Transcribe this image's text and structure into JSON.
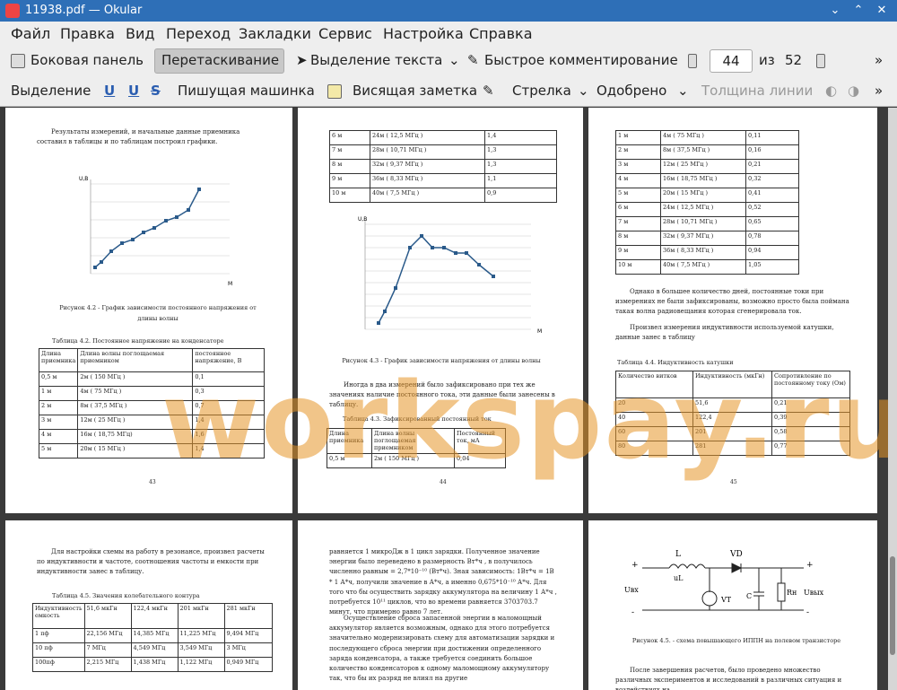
{
  "window": {
    "title": "11938.pdf — Okular"
  },
  "menu": [
    "Файл",
    "Правка",
    "Вид",
    "Переход",
    "Закладки",
    "Сервис",
    "Настройка",
    "Справка"
  ],
  "toolbar1": {
    "sidebar": "Боковая панель",
    "drag": "Перетаскивание",
    "text_select": "Выделение текста",
    "quick_comment": "Быстрое комментирование",
    "page_current": "44",
    "page_of": "из",
    "page_total": "52"
  },
  "toolbar2": {
    "selection": "Выделение",
    "typewriter": "Пишущая машинка",
    "note": "Висящая заметка",
    "arrow": "Стрелка",
    "stamp": "Одобрено",
    "line_width": "Толщина линии"
  },
  "watermark": "workspay.ru",
  "page43": {
    "intro": "Результаты измерений, и начальные данные приемника составил в таблицы и по таблицам построил графики.",
    "chart_ylabel": "U,В",
    "chart_xlabel": "М",
    "caption": "Рисунок 4.2 - График зависимости постоянного напряжения от длины волны",
    "table_title": "Таблица 4.2. Постоянное напряжение на конденсаторе",
    "headers": [
      "Длина приемника",
      "Длина волны поглощаемая приемником",
      "постоянное напряжение, В"
    ],
    "rows": [
      [
        "0,5 м",
        "2м ( 150 МГц )",
        "0,1"
      ],
      [
        "1 м",
        "4м ( 75 МГц )",
        "0,3"
      ],
      [
        "2 м",
        "8м ( 37,5 МГц )",
        "0,7"
      ],
      [
        "3 м",
        "12м ( 25 МГц )",
        "1,4"
      ],
      [
        "4 м",
        "16м ( 18,75 МГц)",
        "1,6"
      ],
      [
        "5 м",
        "20м ( 15 МГц )",
        "1,4"
      ]
    ],
    "number": "43"
  },
  "page44": {
    "rows": [
      [
        "6 м",
        "24м ( 12,5 МГц )",
        "1,4"
      ],
      [
        "7 м",
        "28м ( 10,71 МГц )",
        "1,3"
      ],
      [
        "8 м",
        "32м ( 9,37 МГц )",
        "1,3"
      ],
      [
        "9 м",
        "36м ( 8,33 МГц )",
        "1,1"
      ],
      [
        "10 м",
        "40м ( 7,5 МГц )",
        "0,9"
      ]
    ],
    "chart_ylabel": "U,В",
    "chart_xlabel": "М",
    "caption": "Рисунок 4.3 - График зависимости напряжения от длины волны",
    "para": "Иногда в два измерений было зафиксировано при тех же значениях наличие постоянного тока, эти данные были занесены в таблицу.",
    "table_title": "Таблица 4.3. Зафиксированный постоянный ток",
    "headers": [
      "Длина приемника",
      "Длина волны поглощаемая приемником",
      "Постоянный ток, мА"
    ],
    "trow": [
      "0,5 м",
      "2м ( 150 МГц )",
      "0,04"
    ],
    "number": "44"
  },
  "page45": {
    "rows": [
      [
        "1 м",
        "4м ( 75 МГц )",
        "0,11"
      ],
      [
        "2 м",
        "8м ( 37,5 МГц )",
        "0,16"
      ],
      [
        "3 м",
        "12м ( 25 МГц )",
        "0,21"
      ],
      [
        "4 м",
        "16м ( 18,75 МГц )",
        "0,32"
      ],
      [
        "5 м",
        "20м ( 15 МГц )",
        "0,41"
      ],
      [
        "6 м",
        "24м ( 12,5 МГц )",
        "0,52"
      ],
      [
        "7 м",
        "28м ( 10,71 МГц )",
        "0,65"
      ],
      [
        "8 м",
        "32м ( 9,37 МГц )",
        "0,78"
      ],
      [
        "9 м",
        "36м ( 8,33 МГц )",
        "0,94"
      ],
      [
        "10 м",
        "40м ( 7,5 МГц )",
        "1,05"
      ]
    ],
    "para1": "Однако в большее количество дней, постоянные токи при измерениях не были зафиксированы, возможно просто была поймана такая волна радиовещания которая сгенерировала ток.",
    "para2": "Произвел измерения индуктивности используемой катушки, данные занес в таблицу",
    "table_title": "Таблица 4.4. Индуктивность катушки",
    "headers": [
      "Количество витков",
      "Индуктивность (мкГн)",
      "Сопротивление по постоянному току (Ом)"
    ],
    "trows": [
      [
        "20",
        "51,6",
        "0,21"
      ],
      [
        "40",
        "122,4",
        "0,39"
      ],
      [
        "60",
        "201",
        "0,58"
      ],
      [
        "80",
        "281",
        "0,77"
      ]
    ],
    "number": "45"
  },
  "page46": {
    "para": "Для настройки схемы на работу в резонансе, произвел расчеты по индуктивности и частоте, соотношения частоты и емкости при индуктивности занес в таблицу.",
    "table_title": "Таблица 4.5. Значения колебательного контура",
    "headers": [
      "Индуктивность емкость",
      "51,6 мкГн",
      "122,4 мкГн",
      "201 мкГн",
      "281 мкГн"
    ],
    "rows": [
      [
        "1 пф",
        "22,156 МГц",
        "14,385 МГц",
        "11,225 МГц",
        "9,494 МГц"
      ],
      [
        "10 пф",
        "7 МГц",
        "4,549 МГц",
        "3,549 МГц",
        "3 МГц"
      ],
      [
        "100пф",
        "2,215 МГц",
        "1,438 МГц",
        "1,122 МГц",
        "0,949 МГц"
      ]
    ]
  },
  "page47": {
    "text": "равняется 1 микроДж в 1 цикл зарядки. Полученное значение энергии было переведено в размерность Вт*ч , в получилось численно равным = 2,7*10⁻¹⁰ (Вт*ч). Зная зависимость: 1Вт*ч = 1В * 1 А*ч, получили значение в А*ч, а именно 0,675*10⁻¹⁰ А*ч. Для того что бы осуществить зарядку аккумулятора на величину 1 А*ч , потребуется 10¹¹ циклов, что во времени равняется 3703703.7 минут, что примерно равно 7 лет.",
    "text2": "Осуществление сброса запасенной энергии в маломощный аккумулятор является возможным, однако для этого потребуется значительно модернизировать схему для автоматизации зарядки и последующего сброса энергии при достижении определенного заряда конденсатора, а также требуется соединить большое количество конденсаторов к одному маломощному аккумулятору так, что бы их разряд не влиял на другие"
  },
  "page48": {
    "circuit_labels": [
      "L",
      "VD",
      "+",
      "-",
      "Uвх",
      "uL",
      "VT",
      "C",
      "Rн",
      "Uвых",
      "+",
      "-"
    ],
    "caption": "Рисунок 4.5. - схема повышающего ИППН на полевом транзисторе",
    "para": "После завершения расчетов, было проведено множество различных экспериментов и исследований в различных ситуация и воздействиях на"
  }
}
